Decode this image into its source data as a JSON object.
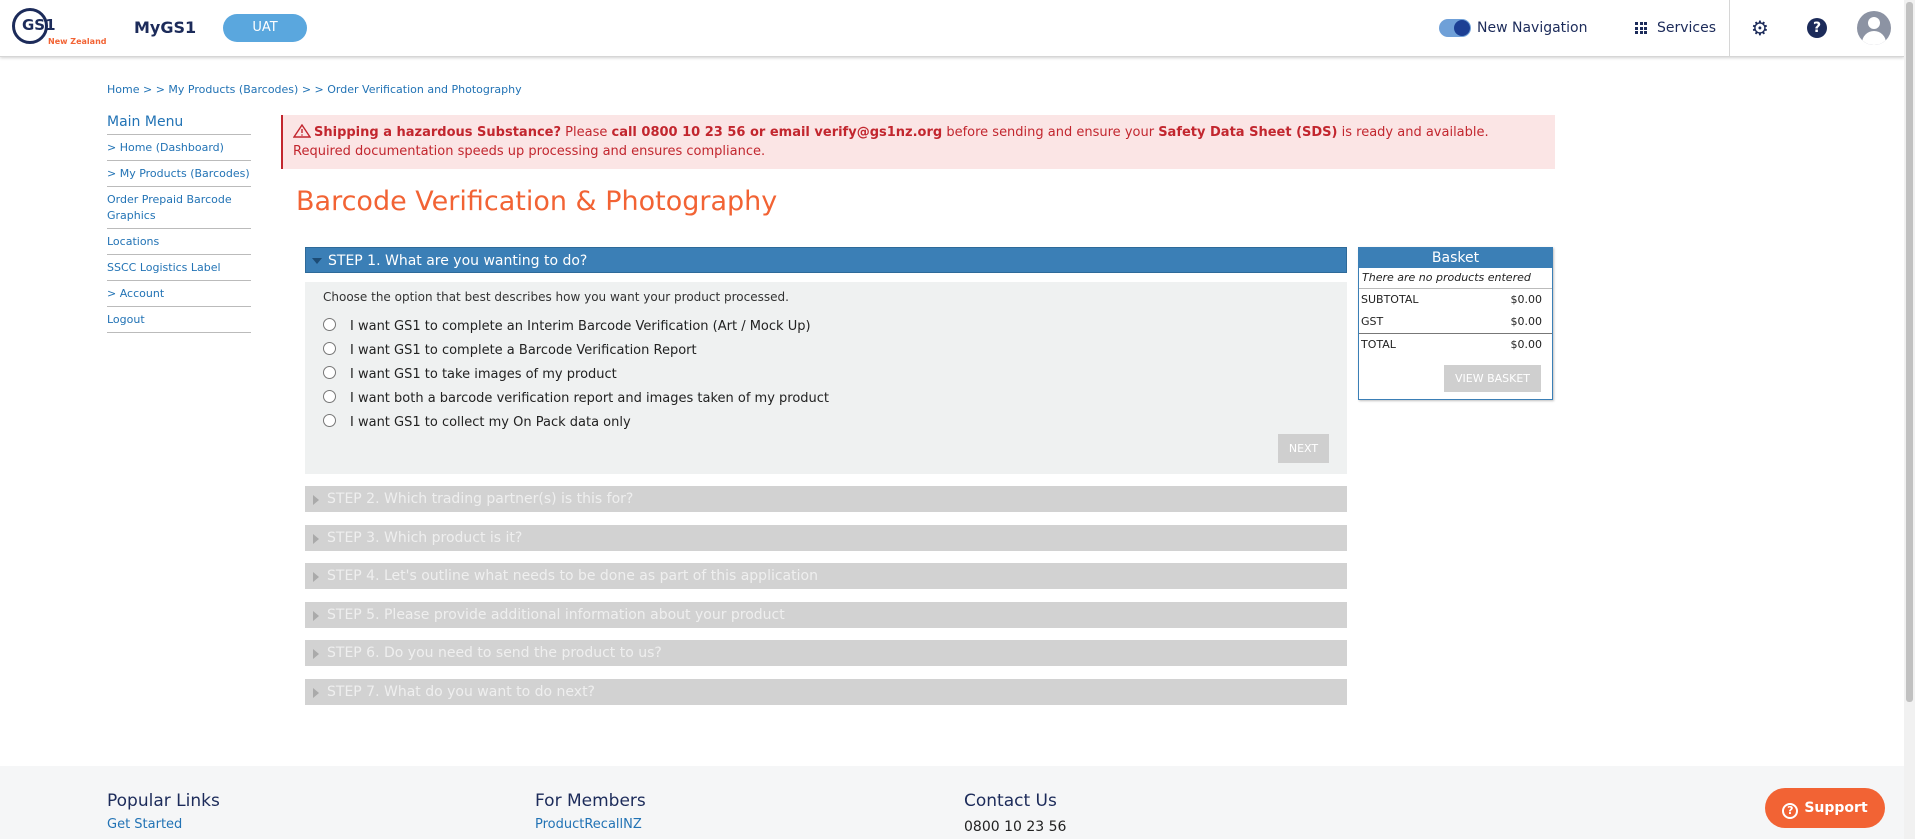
{
  "header": {
    "logo_text": "GS1",
    "logo_sub": "New Zealand",
    "app_title": "MyGS1",
    "env_label": "UAT",
    "new_navigation_label": "New Navigation",
    "new_navigation_on": true,
    "services_label": "Services",
    "help_glyph": "?"
  },
  "breadcrumb": {
    "home": "Home",
    "sep1": " > ",
    "sep2": "> ",
    "my_products": "My Products (Barcodes)",
    "sep3": " > ",
    "sep4": "> ",
    "current": "Order Verification and Photography"
  },
  "sidebar": {
    "title": "Main Menu",
    "items": [
      {
        "label": "> Home (Dashboard)"
      },
      {
        "label": "> My Products (Barcodes)"
      },
      {
        "label": "Order Prepaid Barcode Graphics"
      },
      {
        "label": "Locations"
      },
      {
        "label": "SSCC Logistics Label"
      },
      {
        "label": "> Account"
      },
      {
        "label": "Logout"
      }
    ]
  },
  "alert": {
    "strong1": "Shipping a hazardous Substance?",
    "text1": " Please ",
    "strong2": "call 0800 10 23 56 or email verify@gs1nz.org",
    "text2": " before sending and ensure your ",
    "strong3": "Safety Data Sheet (SDS)",
    "text3": " is ready and available. Required documentation speeds up processing and ensures compliance."
  },
  "page_title": "Barcode Verification & Photography",
  "steps": [
    {
      "label": "STEP 1. What are you wanting to do?",
      "active": true
    },
    {
      "label": "STEP 2. Which trading partner(s) is this for?",
      "active": false
    },
    {
      "label": "STEP 3. Which product is it?",
      "active": false
    },
    {
      "label": "STEP 4. Let's outline what needs to be done as part of this application",
      "active": false
    },
    {
      "label": "STEP 5. Please provide additional information about your product",
      "active": false
    },
    {
      "label": "STEP 6. Do you need to send the product to us?",
      "active": false
    },
    {
      "label": "STEP 7. What do you want to do next?",
      "active": false
    }
  ],
  "step1": {
    "description": "Choose the option that best describes how you want your product processed.",
    "options": [
      {
        "label": "I want GS1 to complete an Interim Barcode Verification (Art / Mock Up)"
      },
      {
        "label": "I want GS1 to complete a Barcode Verification Report"
      },
      {
        "label": "I want GS1 to take images of my product"
      },
      {
        "label": "I want both a barcode verification report and images taken of my product"
      },
      {
        "label": "I want GS1 to collect my On Pack data only"
      }
    ],
    "next_label": "NEXT"
  },
  "basket": {
    "title": "Basket",
    "empty_text": "There are no products entered",
    "rows": [
      {
        "label": "SUBTOTAL",
        "amount": "$0.00"
      },
      {
        "label": "GST",
        "amount": "$0.00"
      },
      {
        "label": "TOTAL",
        "amount": "$0.00"
      }
    ],
    "view_label": "VIEW BASKET"
  },
  "footer": {
    "popular_links": {
      "title": "Popular Links",
      "first_link": "Get Started"
    },
    "for_members": {
      "title": "For Members",
      "first_link": "ProductRecallNZ"
    },
    "contact": {
      "title": "Contact Us",
      "phone": "0800 10 23 56"
    },
    "support_label": "Support",
    "support_glyph": "?"
  },
  "colors": {
    "brand_navy": "#1c2b5a",
    "accent_orange": "#f26334",
    "step_active_blue": "#3b7fb6",
    "link_blue": "#2273b5",
    "alert_red": "#c2262e"
  }
}
